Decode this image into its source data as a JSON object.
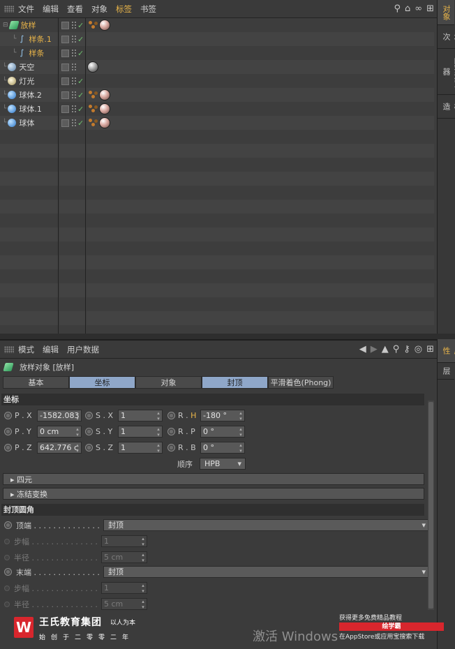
{
  "object_manager": {
    "menu": [
      "文件",
      "编辑",
      "查看",
      "对象",
      "标签",
      "书签"
    ],
    "active_menu_index": 4,
    "objects": [
      {
        "name": "放样",
        "indent": 0,
        "icon": "loft-icon",
        "selected": true,
        "check": true,
        "tags": [
          "phong",
          "mat"
        ]
      },
      {
        "name": "样条.1",
        "indent": 1,
        "icon": "spline-icon",
        "selected": true,
        "check": true,
        "tags": []
      },
      {
        "name": "样条",
        "indent": 1,
        "icon": "spline-icon",
        "selected": true,
        "check": true,
        "tags": []
      },
      {
        "name": "天空",
        "indent": 0,
        "icon": "sky-icon",
        "selected": false,
        "check": false,
        "tags": [
          "mat-gray"
        ]
      },
      {
        "name": "灯光",
        "indent": 0,
        "icon": "light-icon",
        "selected": false,
        "check": true,
        "tags": []
      },
      {
        "name": "球体.2",
        "indent": 0,
        "icon": "sphere-icon",
        "selected": false,
        "check": true,
        "tags": [
          "phong",
          "mat"
        ]
      },
      {
        "name": "球体.1",
        "indent": 0,
        "icon": "sphere-icon",
        "selected": false,
        "check": true,
        "tags": [
          "phong",
          "mat"
        ]
      },
      {
        "name": "球体",
        "indent": 0,
        "icon": "sphere-icon",
        "selected": false,
        "check": true,
        "tags": [
          "phong",
          "mat"
        ]
      }
    ],
    "side_tabs": [
      "对象",
      "场次",
      "内容浏览器",
      "构造"
    ]
  },
  "attribute_manager": {
    "menu": [
      "模式",
      "编辑",
      "用户数据"
    ],
    "title": "放样对象 [放样]",
    "tabs": [
      "基本",
      "坐标",
      "对象",
      "封顶",
      "平滑着色(Phong)"
    ],
    "active_tabs": [
      1,
      3
    ],
    "coord_section": "坐标",
    "coords": {
      "px_label": "P . X",
      "px": "-1582.083",
      "py_label": "P . Y",
      "py": "0 cm",
      "pz_label": "P . Z",
      "pz": "642.776 c",
      "sx_label": "S . X",
      "sx": "1",
      "sy_label": "S . Y",
      "sy": "1",
      "sz_label": "S . Z",
      "sz": "1",
      "rh_label_r": "R . ",
      "rh_label_h": "H",
      "rh": "-180 °",
      "rp_label": "R . P",
      "rp": "0 °",
      "rb_label": "R . B",
      "rb": "0 °",
      "order_label": "顺序",
      "order": "HPB"
    },
    "quaternion": "四元",
    "freeze": "冻结变换",
    "cap_section": "封顶圆角",
    "caps": {
      "top_label": "顶端 . . . . . . . . . . . . . .",
      "top_value": "封顶",
      "steps1_label": "步幅 . . . . . . . . . . . . . .",
      "steps1": "1",
      "radius1_label": "半径 . . . . . . . . . . . . . .",
      "radius1": "5 cm",
      "end_label": "末端 . . . . . . . . . . . . . .",
      "end_value": "封顶",
      "steps2_label": "步幅 . . . . . . . . . . . . . .",
      "steps2": "1",
      "radius2_label": "半径 . . . . . . . . . . . . . .",
      "radius2": "5 cm"
    },
    "side_tabs": [
      "属性",
      "层"
    ]
  },
  "overlay": {
    "logo_letter": "W",
    "brand": "王氏教育集团",
    "slogan": "以人为本",
    "motto": "始创于二零零二年",
    "windows_activate": "激活 Windows",
    "promo_line1": "获得更多免费精品教程",
    "promo_tag": "绘学霸",
    "promo_line2": "在AppStore或应用宝搜索下载"
  },
  "colors": {
    "accent": "#e8b449",
    "tab_active": "#8fa7c9",
    "brand_red": "#d8262d"
  }
}
